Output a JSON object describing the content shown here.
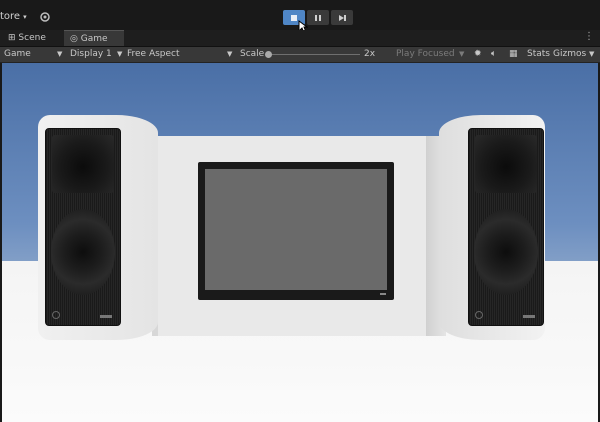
{
  "topbar": {
    "store_label": "tore",
    "play_buttons": [
      "stop",
      "pause",
      "step"
    ]
  },
  "tabs": [
    {
      "label": "Scene",
      "icon": "grid-icon"
    },
    {
      "label": "Game",
      "icon": "gamepad-icon"
    }
  ],
  "toolbar": {
    "mode": "Game",
    "display": "Display 1",
    "aspect": "Free Aspect",
    "scale_label": "Scale",
    "scale_value": "2x",
    "play_focused": "Play Focused",
    "stats": "Stats",
    "gizmos": "Gizmos"
  },
  "colors": {
    "accent": "#4f86c6",
    "panel": "#383838",
    "sky": "#5b7fb5"
  }
}
